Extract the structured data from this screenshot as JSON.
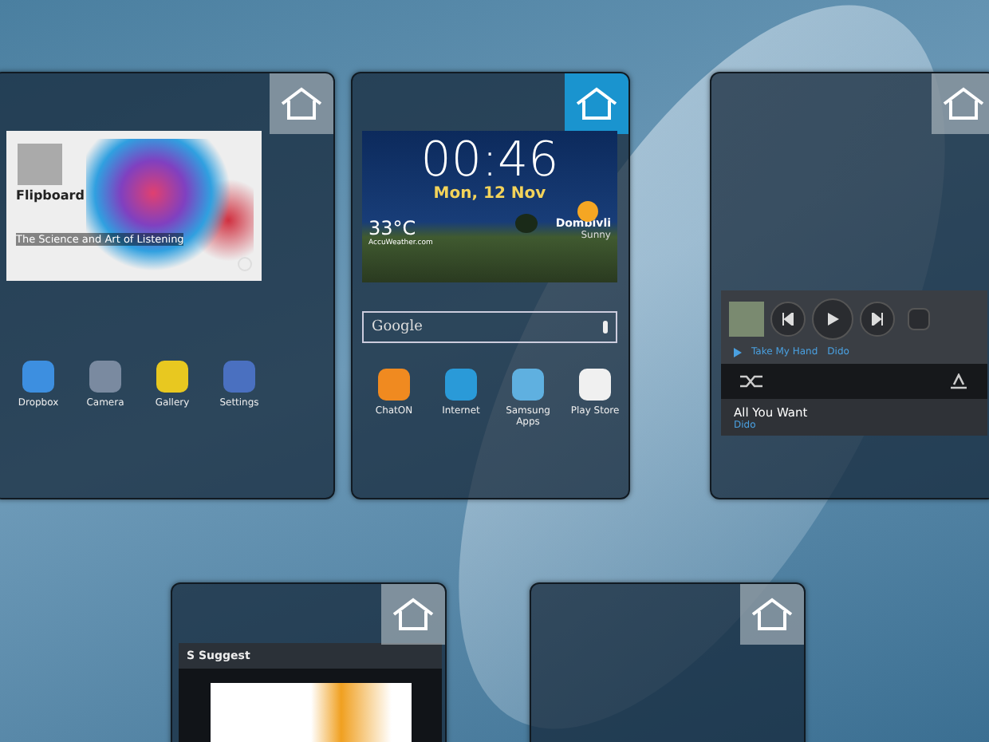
{
  "panels": [
    {
      "home_selected": false,
      "widgets": [
        {
          "kind": "flipboard",
          "brand": "Flipboard",
          "headline": "The Science and Art of Listening"
        },
        {
          "kind": "apps",
          "apps": [
            {
              "label": "Dropbox"
            },
            {
              "label": "Camera"
            },
            {
              "label": "Gallery"
            },
            {
              "label": "Settings"
            }
          ]
        }
      ]
    },
    {
      "home_selected": true,
      "widgets": [
        {
          "kind": "clock",
          "time": "00:46",
          "date": "Mon, 12 Nov",
          "temperature": "33°C",
          "source": "AccuWeather.com",
          "city": "Dombivli",
          "condition": "Sunny"
        },
        {
          "kind": "search",
          "placeholder": "Google"
        },
        {
          "kind": "apps",
          "apps": [
            {
              "label": "ChatON"
            },
            {
              "label": "Internet"
            },
            {
              "label": "Samsung Apps"
            },
            {
              "label": "Play Store"
            }
          ]
        }
      ]
    },
    {
      "home_selected": false,
      "widgets": [
        {
          "kind": "music",
          "now_playing": "Take My Hand",
          "now_artist": "Dido",
          "track": "All You Want",
          "artist": "Dido"
        }
      ]
    },
    {
      "home_selected": false,
      "widgets": [
        {
          "kind": "suggest",
          "title": "S Suggest"
        }
      ]
    },
    {
      "home_selected": false
    }
  ]
}
